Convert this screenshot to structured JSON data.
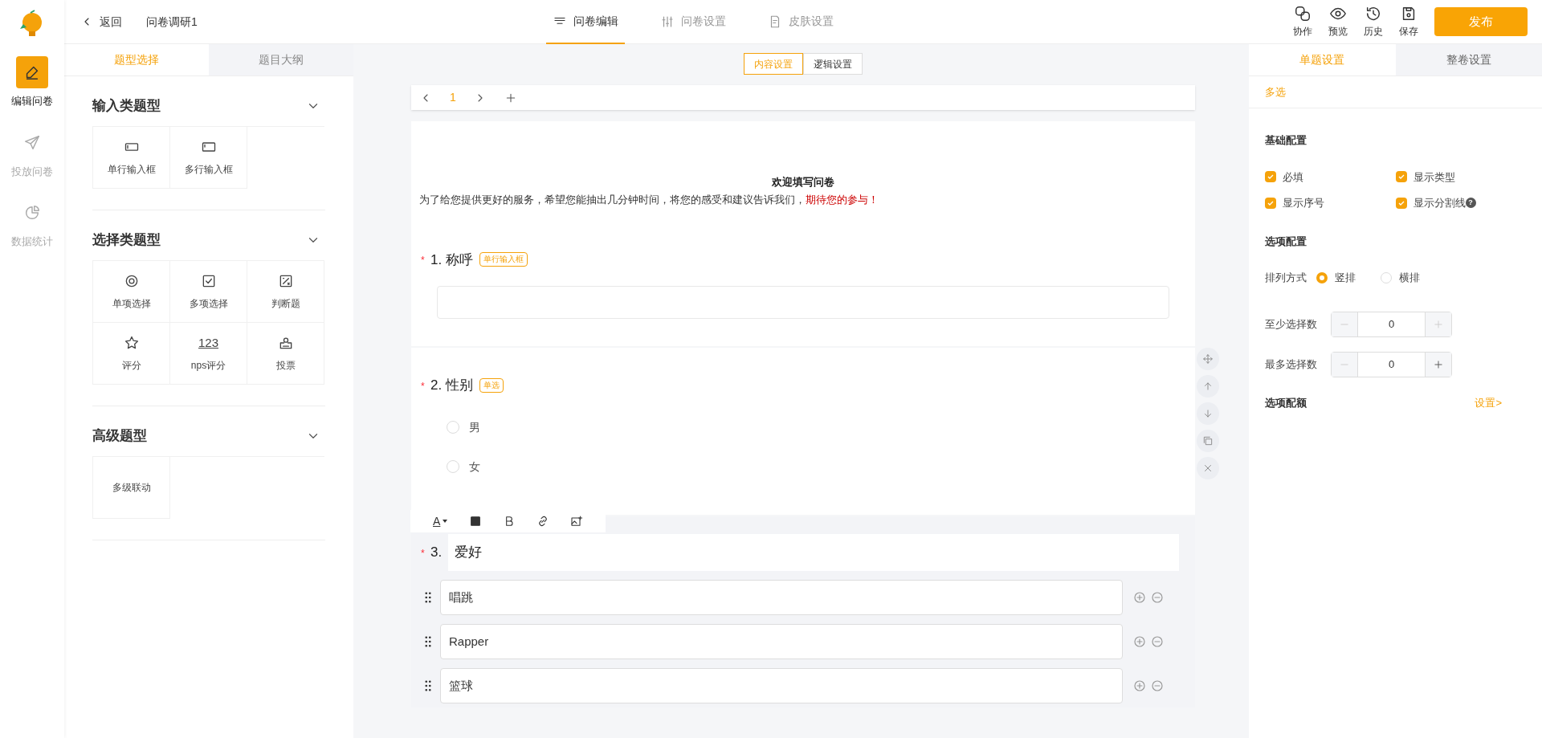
{
  "sidebar": {
    "items": [
      {
        "label": "编辑问卷",
        "kind": "edit",
        "selected": true
      },
      {
        "label": "投放问卷",
        "kind": "send",
        "selected": false
      },
      {
        "label": "数据统计",
        "kind": "chart",
        "selected": false
      }
    ]
  },
  "header": {
    "back": "返回",
    "title": "问卷调研1",
    "tabs": [
      {
        "label": "问卷编辑",
        "kind": "edit",
        "selected": true
      },
      {
        "label": "问卷设置",
        "kind": "settings",
        "selected": false
      },
      {
        "label": "皮肤设置",
        "kind": "skin",
        "selected": false
      }
    ],
    "actions": [
      {
        "label": "协作",
        "kind": "link"
      },
      {
        "label": "预览",
        "kind": "eye"
      },
      {
        "label": "历史",
        "kind": "clock"
      },
      {
        "label": "保存",
        "kind": "save"
      }
    ],
    "publish": "发布"
  },
  "left_panel": {
    "tabs": [
      {
        "label": "题型选择",
        "selected": true
      },
      {
        "label": "题目大纲",
        "selected": false
      }
    ],
    "groups": [
      {
        "title": "输入类题型",
        "expanded": true,
        "items": [
          {
            "label": "单行输入框",
            "kind": "input"
          },
          {
            "label": "多行输入框",
            "kind": "textarea"
          }
        ]
      },
      {
        "title": "选择类题型",
        "expanded": true,
        "items": [
          {
            "label": "单项选择",
            "kind": "radio"
          },
          {
            "label": "多项选择",
            "kind": "checkbox"
          },
          {
            "label": "判断题",
            "kind": "judge"
          },
          {
            "label": "评分",
            "kind": "star"
          },
          {
            "label": "nps评分",
            "kind": "nps",
            "glyph": "123"
          },
          {
            "label": "投票",
            "kind": "vote"
          }
        ]
      },
      {
        "title": "高级题型",
        "expanded": true,
        "items": [
          {
            "label": "多级联动",
            "kind": "plain"
          }
        ]
      }
    ]
  },
  "center": {
    "mode_tabs": [
      {
        "label": "内容设置",
        "selected": true
      },
      {
        "label": "逻辑设置",
        "selected": false
      }
    ],
    "pager": {
      "page": "1"
    },
    "intro": {
      "title": "欢迎填写问卷",
      "text": "为了给您提供更好的服务，希望您能抽出几分钟时间，将您的感受和建议告诉我们，",
      "highlight": "期待您的参与！"
    },
    "questions": [
      {
        "kind": "input",
        "required_mark": "*",
        "number": "1.",
        "title": "称呼",
        "tag": "单行输入框"
      },
      {
        "kind": "radio",
        "required_mark": "*",
        "number": "2.",
        "title": "性别",
        "tag": "单选",
        "options": [
          {
            "label": "男",
            "selected": false
          },
          {
            "label": "女",
            "selected": false
          }
        ]
      },
      {
        "kind": "editing",
        "required_mark": "*",
        "number": "3.",
        "title": "爱好",
        "font_color_button": "A",
        "options": [
          {
            "label": "唱跳"
          },
          {
            "label": "Rapper"
          },
          {
            "label": "篮球"
          }
        ]
      }
    ]
  },
  "right_panel": {
    "tabs": [
      {
        "label": "单题设置",
        "selected": true
      },
      {
        "label": "整卷设置",
        "selected": false
      }
    ],
    "type_label": "多选",
    "basic_title": "基础配置",
    "checks": [
      {
        "label": "必填",
        "checked": true
      },
      {
        "label": "显示类型",
        "checked": true
      },
      {
        "label": "显示序号",
        "checked": true
      },
      {
        "label": "显示分割线",
        "checked": true,
        "help": "?"
      }
    ],
    "option_title": "选项配置",
    "layout_label": "排列方式",
    "layout": [
      {
        "label": "竖排",
        "selected": true
      },
      {
        "label": "横排",
        "selected": false
      }
    ],
    "steppers": [
      {
        "label": "至少选择数",
        "value": "0",
        "minus_disabled": true,
        "plus_disabled": true
      },
      {
        "label": "最多选择数",
        "value": "0",
        "minus_disabled": true,
        "plus_disabled": false
      }
    ],
    "quota_title": "选项配额",
    "quota_link": "设置>"
  }
}
